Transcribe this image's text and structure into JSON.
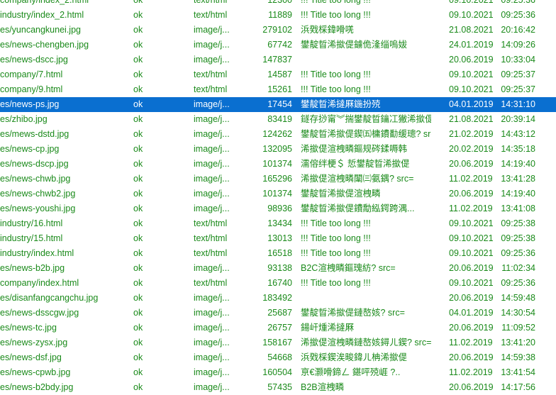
{
  "rows": [
    {
      "url": "company/index_2.html",
      "status": "ok",
      "type": "text/html",
      "size": "12300",
      "title": "!!! Title too long !!!",
      "date": "09.10.2021",
      "time": "09:25:36"
    },
    {
      "url": "industry/index_2.html",
      "status": "ok",
      "type": "text/html",
      "size": "11889",
      "title": "!!! Title too long !!!",
      "date": "09.10.2021",
      "time": "09:25:36"
    },
    {
      "url": "es/yuncangkunei.jpg",
      "status": "ok",
      "type": "image/j...",
      "size": "279102",
      "title": "浜戣棌鍏嗗唴",
      "date": "21.08.2021",
      "time": "20:16:42"
    },
    {
      "url": "es/news-chengben.jpg",
      "status": "ok",
      "type": "image/j...",
      "size": "67742",
      "title": "鐢靛晢浠撳偍鐪佹湰缁嗚妭",
      "date": "24.01.2019",
      "time": "14:09:26"
    },
    {
      "url": "es/news-dscc.jpg",
      "status": "ok",
      "type": "image/j...",
      "size": "147837",
      "title": "",
      "date": "20.06.2019",
      "time": "10:33:04"
    },
    {
      "url": "company/7.html",
      "status": "ok",
      "type": "text/html",
      "size": "14587",
      "title": "!!! Title too long !!!",
      "date": "09.10.2021",
      "time": "09:25:37"
    },
    {
      "url": "company/9.html",
      "status": "ok",
      "type": "text/html",
      "size": "15261",
      "title": "!!! Title too long !!!",
      "date": "09.10.2021",
      "time": "09:25:37"
    },
    {
      "url": "es/news-ps.jpg",
      "status": "ok",
      "type": "image/j...",
      "size": "17454",
      "title": "鐢靛晢浠撻厤鍦扮殑",
      "date": "04.01.2019",
      "time": "14:31:10",
      "selected": true
    },
    {
      "url": "es/zhibo.jpg",
      "status": "ok",
      "type": "image/j...",
      "size": "83419",
      "title": "鐩存挱甯︾揣鐢靛晢鑰冮獙浠撳偍...",
      "date": "21.08.2021",
      "time": "20:39:14"
    },
    {
      "url": "es/mews-dstd.jpg",
      "status": "ok",
      "type": "image/j...",
      "size": "124262",
      "title": "鐢靛晢浠撳偍鍥㈤槦鐨勫缓璁? src=",
      "date": "21.02.2019",
      "time": "14:43:12"
    },
    {
      "url": "es/news-cp.jpg",
      "status": "ok",
      "type": "image/j...",
      "size": "132095",
      "title": "浠撳偍渲栧疄鏂规硶鍒嗕韩",
      "date": "20.02.2019",
      "time": "14:35:18"
    },
    {
      "url": "es/news-dscp.jpg",
      "status": "ok",
      "type": "image/j...",
      "size": "101374",
      "title": "濡傛绊梗＄ 悊鐢靛晢浠撳偍",
      "date": "20.06.2019",
      "time": "14:19:40"
    },
    {
      "url": "es/news-chwb.jpg",
      "status": "ok",
      "type": "image/j...",
      "size": "165296",
      "title": "浠撳偍渲栧疄闈㈢氨鍝? src=",
      "date": "11.02.2019",
      "time": "13:41:28"
    },
    {
      "url": "es/news-chwb2.jpg",
      "status": "ok",
      "type": "image/j...",
      "size": "101374",
      "title": "鐢靛晢浠撳偍渲栧疄",
      "date": "20.06.2019",
      "time": "14:19:40"
    },
    {
      "url": "es/news-youshi.jpg",
      "status": "ok",
      "type": "image/j...",
      "size": "98936",
      "title": "鐢靛晢浠撳偍鐨勪紭鍔跨湡...",
      "date": "11.02.2019",
      "time": "13:41:08"
    },
    {
      "url": "industry/16.html",
      "status": "ok",
      "type": "text/html",
      "size": "13434",
      "title": "!!! Title too long !!!",
      "date": "09.10.2021",
      "time": "09:25:38"
    },
    {
      "url": "industry/15.html",
      "status": "ok",
      "type": "text/html",
      "size": "13013",
      "title": "!!! Title too long !!!",
      "date": "09.10.2021",
      "time": "09:25:38"
    },
    {
      "url": "industry/index.html",
      "status": "ok",
      "type": "text/html",
      "size": "16518",
      "title": "!!! Title too long !!!",
      "date": "09.10.2021",
      "time": "09:25:36"
    },
    {
      "url": "es/news-b2b.jpg",
      "status": "ok",
      "type": "image/j...",
      "size": "93138",
      "title": "B2C渲栧疄鏂瑰紡? src=",
      "date": "20.06.2019",
      "time": "11:02:34"
    },
    {
      "url": "company/index.html",
      "status": "ok",
      "type": "text/html",
      "size": "16740",
      "title": "!!! Title too long !!!",
      "date": "09.10.2021",
      "time": "09:25:36"
    },
    {
      "url": "es/disanfangcangchu.jpg",
      "status": "ok",
      "type": "image/j...",
      "size": "183492",
      "title": "",
      "date": "20.06.2019",
      "time": "14:59:48"
    },
    {
      "url": "es/news-dsscgw.jpg",
      "status": "ok",
      "type": "image/j...",
      "size": "25687",
      "title": "鐢靛晢浠撳偍鏈嶅姟? src=",
      "date": "04.01.2019",
      "time": "14:30:54"
    },
    {
      "url": "es/news-tc.jpg",
      "status": "ok",
      "type": "image/j...",
      "size": "26757",
      "title": "鍚屽煄浠撻厤",
      "date": "20.06.2019",
      "time": "11:09:52"
    },
    {
      "url": "es/news-zysx.jpg",
      "status": "ok",
      "type": "image/j...",
      "size": "158167",
      "title": "浠撳偍渲栧疄鏈嶅姟鐞ㄦ鍥? src=",
      "date": "11.02.2019",
      "time": "13:41:20"
    },
    {
      "url": "es/news-dsf.jpg",
      "status": "ok",
      "type": "image/j...",
      "size": "54668",
      "title": "浜戣棌鍥涘畯鍏ㄦ柟浠撳偍",
      "date": "20.06.2019",
      "time": "14:59:38"
    },
    {
      "url": "es/news-cpwb.jpg",
      "status": "ok",
      "type": "image/j...",
      "size": "160504",
      "title": "亰€灏嗗鍗ㄥ 鍖呯殑崕 ?..",
      "date": "11.02.2019",
      "time": "13:41:54"
    },
    {
      "url": "es/news-b2bdy.jpg",
      "status": "ok",
      "type": "image/j...",
      "size": "57435",
      "title": "B2B渲栧疄",
      "date": "20.06.2019",
      "time": "14:17:56"
    }
  ]
}
